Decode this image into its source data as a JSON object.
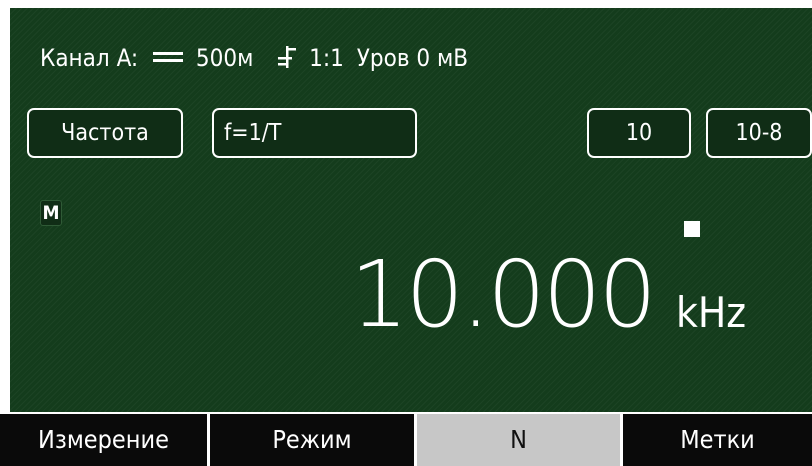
{
  "status": {
    "channel": "Канал A:",
    "coupling_icon": "dc-coupling-icon",
    "timebase": "500м",
    "trigger_icon": "trigger-slope-icon",
    "ratio": "1:1",
    "level": "Уров 0 мВ"
  },
  "controls": {
    "function_label": "Частота",
    "formula_label": "f=1/T",
    "gate_label": "10",
    "resolution_label": "10-8"
  },
  "display": {
    "mode_flag": "M",
    "value": "10.000",
    "unit": "kHz"
  },
  "softkeys": [
    {
      "label": "Измерение",
      "selected": false
    },
    {
      "label": "Режим",
      "selected": false
    },
    {
      "label": "N",
      "selected": true
    },
    {
      "label": "Метки",
      "selected": false
    }
  ],
  "colors": {
    "screen_bg": "#143c1c",
    "softkey_bg": "#0a0a0a",
    "softkey_selected_bg": "#c7c7c7",
    "foreground": "#ffffff"
  }
}
